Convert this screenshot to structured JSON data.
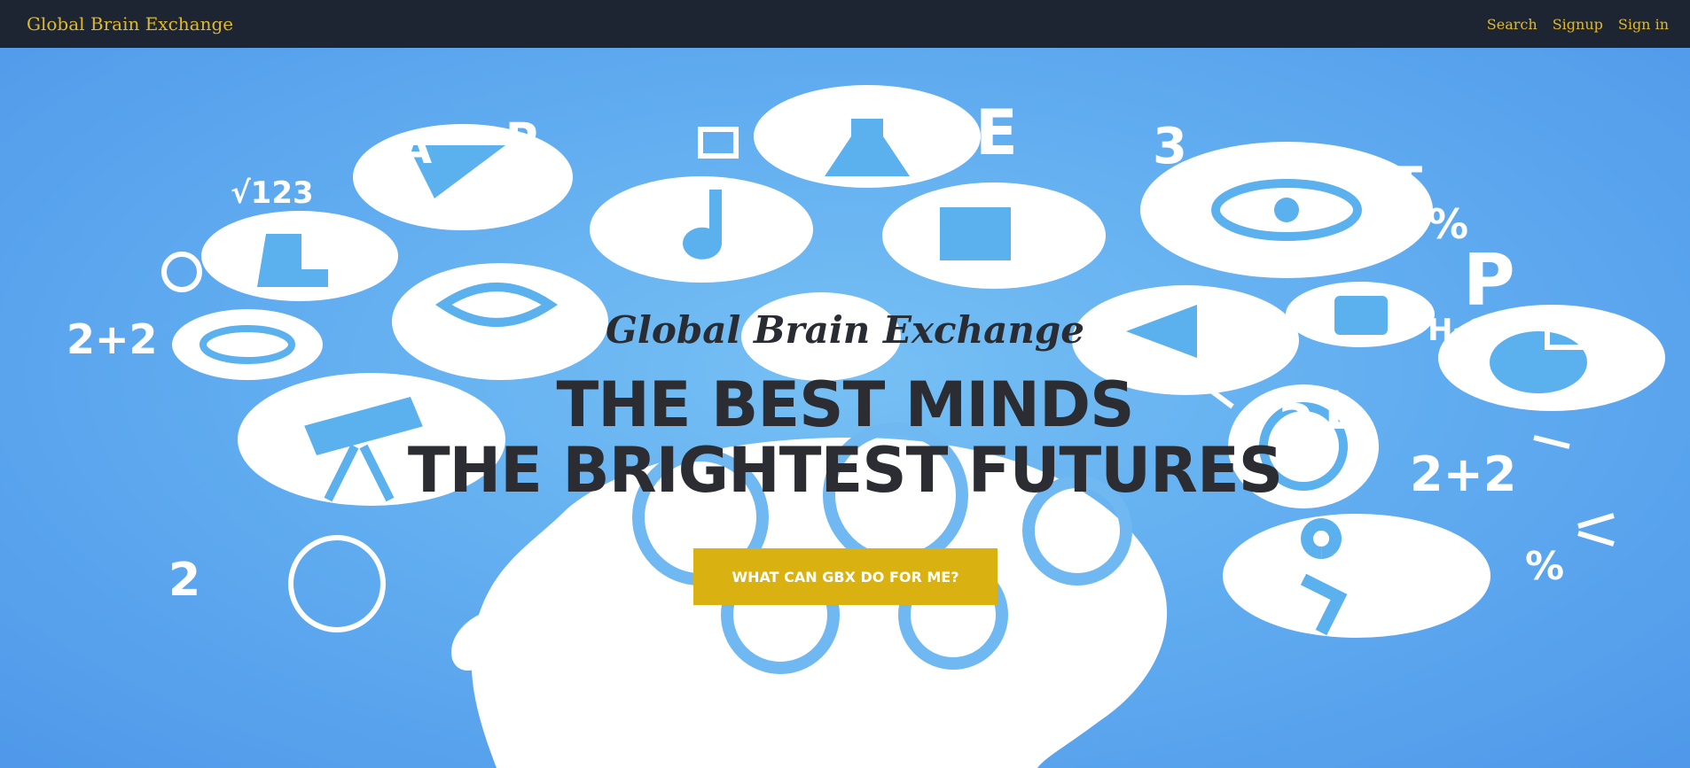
{
  "navbar": {
    "brand": "Global Brain Exchange",
    "links": [
      "Search",
      "Signup",
      "Sign in"
    ]
  },
  "hero": {
    "subtitle": "Global Brain Exchange",
    "headline_line1": "THE BEST MINDS",
    "headline_line2": "THE BRIGHTEST FUTURES",
    "cta_label": "WHAT CAN GBX DO FOR ME?"
  },
  "background": {
    "image": "head-silhouette-with-education-icons",
    "icons": [
      "flask-icon",
      "atom-icon",
      "music-note-icon",
      "dna-icon",
      "telescope-icon",
      "microscope-icon",
      "calculator-icon",
      "paint-palette-icon",
      "globe-icon",
      "gears-icon",
      "checkbox-icon",
      "scissors-icon"
    ]
  },
  "colors": {
    "navbar_bg": "#1e2532",
    "nav_text": "#e0b92b",
    "hero_blue": "#62aef0",
    "cta_bg": "#d9b211",
    "headline_text": "#2b2d33"
  }
}
